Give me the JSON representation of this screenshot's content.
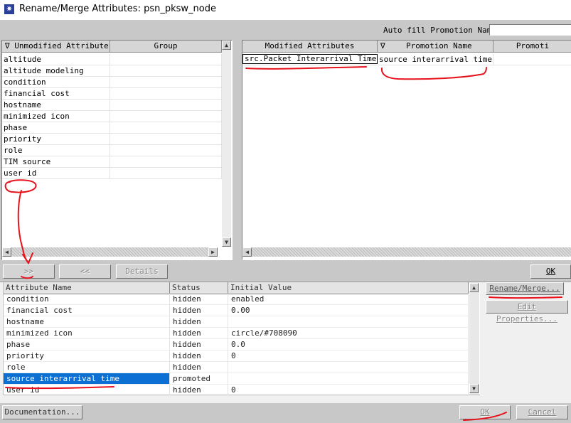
{
  "window": {
    "title": "Rename/Merge Attributes: psn_pksw_node",
    "icon": "star-icon"
  },
  "auto_fill": {
    "label": "Auto fill Promotion Name",
    "value": ""
  },
  "unmodified": {
    "headers": [
      "Unmodified Attributes",
      "Group"
    ],
    "sort_glyph": "∇",
    "rows": [
      "altitude",
      "altitude modeling",
      "condition",
      "financial cost",
      "hostname",
      "minimized icon",
      "phase",
      "priority",
      "role",
      "TIM source",
      "user id"
    ]
  },
  "modified": {
    "headers": [
      "Modified Attributes",
      "Promotion Name",
      "Promoti"
    ],
    "sort_glyph": "∇",
    "rows": [
      {
        "attribute": "src.Packet Interarrival Time",
        "promotion": "source interarrival time"
      }
    ]
  },
  "buttons": {
    "move_right": ">>",
    "move_left": "<<",
    "details": "Details",
    "ok_top": "OK",
    "rename_merge": "Rename/Merge...",
    "edit_properties": "Edit Properties...",
    "documentation": "Documentation...",
    "ok": "OK",
    "cancel": "Cancel"
  },
  "bottom_table": {
    "headers": [
      "Attribute Name",
      "Status",
      "Initial Value"
    ],
    "rows": [
      {
        "name": "condition",
        "status": "hidden",
        "value": "enabled"
      },
      {
        "name": "financial cost",
        "status": "hidden",
        "value": "0.00"
      },
      {
        "name": "hostname",
        "status": "hidden",
        "value": ""
      },
      {
        "name": "minimized icon",
        "status": "hidden",
        "value": "circle/#708090"
      },
      {
        "name": "phase",
        "status": "hidden",
        "value": "0.0"
      },
      {
        "name": "priority",
        "status": "hidden",
        "value": "0"
      },
      {
        "name": "role",
        "status": "hidden",
        "value": ""
      },
      {
        "name": "source interarrival time",
        "status": "promoted",
        "value": "",
        "selected": true
      },
      {
        "name": "user id",
        "status": "hidden",
        "value": "0"
      }
    ]
  },
  "colors": {
    "selection": "#0b6fd4",
    "annotation": "#e8121c"
  }
}
